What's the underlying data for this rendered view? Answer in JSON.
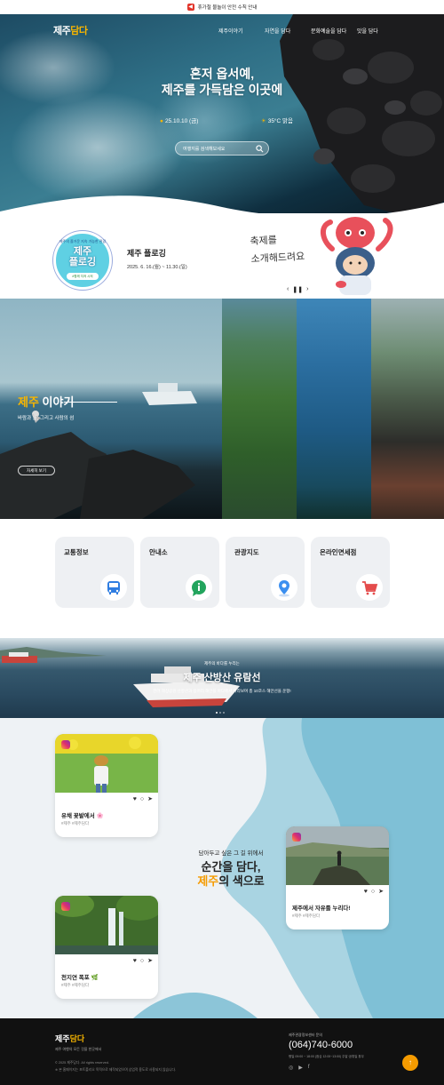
{
  "topbar": {
    "notice": "휴가철 물놀이 안전 수칙 안내",
    "icon": "megaphone-icon"
  },
  "header": {
    "logo_main": "제주",
    "logo_accent": "담다",
    "nav": [
      "제주이야기",
      "자연을 담다",
      "문화예술을 담다",
      "맛을 담다"
    ]
  },
  "hero": {
    "headline_1": "혼저 옵서예,",
    "headline_2": "제주를 가득담은 이곳에",
    "date": "25.10.10 (금)",
    "temperature": "35°C 맑음",
    "search_placeholder": "여행지를 검색해보세요"
  },
  "festival": {
    "badge_top": "제주의 즐거운 지속 가능한 관광",
    "badge_main_1": "제주",
    "badge_main_2": "플로깅",
    "badge_bottom": "#함께 지켜 시켜",
    "title": "제주 플로깅",
    "date": "2025. 6. 16.(월) ~ 11.30.(일)",
    "handwriting_1": "축제를",
    "handwriting_2": "소개해드려요",
    "pager_prev": "‹",
    "pager_pause": "❚❚",
    "pager_next": "›"
  },
  "story": {
    "title_accent": "제주",
    "title_rest": " 이야기",
    "subtitle": "바람과 돌, 그리고 사람의 섬",
    "button": "자세히 보기"
  },
  "quick_menu": [
    {
      "label": "교통정보",
      "icon": "bus-icon",
      "color": "#2f7de1"
    },
    {
      "label": "안내소",
      "icon": "info-chat-icon",
      "color": "#22a45d"
    },
    {
      "label": "관광지도",
      "icon": "map-pin-icon",
      "color": "#3b8ff0"
    },
    {
      "label": "온라인면세점",
      "icon": "shopping-cart-icon",
      "color": "#e44c4c"
    }
  ],
  "cruise": {
    "tag": "제주의 바다를 누리는",
    "title": "제주 산방산 유람선",
    "desc": "한려 해상공원 산방산과 용머리 해안을 바다에서 바라보며 총 10코스 해안선을 운항!"
  },
  "instagram": {
    "question": "담아두고 싶은 그 길 위에서",
    "heading_1": "순간을 담다,",
    "heading_accent": "제주",
    "heading_2": "의 색으로",
    "cards": [
      {
        "caption": "유채 꽃밭에서 🌸",
        "tags": "#제주 #제주담다"
      },
      {
        "caption": "제주에서 자유를 누리다!",
        "tags": "#제주 #제주담다"
      },
      {
        "caption": "천지연 폭포 🌿",
        "tags": "#제주 #제주담다"
      }
    ]
  },
  "footer": {
    "logo_main": "제주",
    "logo_accent": "담다",
    "slogan": "제주 여행의 모든 것을 한곳에서",
    "copyright": "© 2025 제주담다. All rights reserved.",
    "note": "※ 본 홈페이지는 포트폴리오 목적으로 제작되었으며 상업적 용도로 사용되지 않습니다.",
    "contact_label": "제주관광정보센터 문의",
    "phone": "(064)740-6000",
    "hours": "평일 09:00 ~ 18:00 (점심 12:00~13:00) 주말·공휴일 휴무",
    "sns": [
      "instagram-icon",
      "youtube-icon",
      "facebook-icon"
    ],
    "top_button": "↑"
  }
}
